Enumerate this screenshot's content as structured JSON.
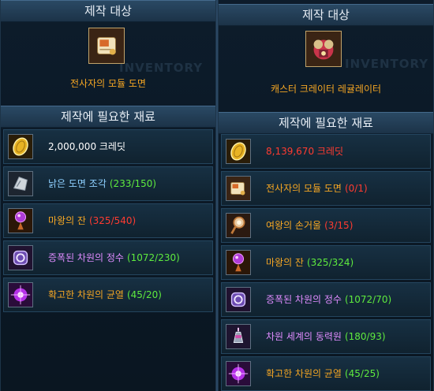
{
  "left": {
    "target_header": "제작 대상",
    "target_name": "전사자의 모듈 도면",
    "target_icon": "blueprint-scroll-icon",
    "materials_header": "제작에 필요한 재료",
    "watermark": "INVENTORY",
    "materials": [
      {
        "icon": "credit-coin-icon",
        "name": "2,000,000 크레딧",
        "count": "",
        "name_color": "#ffffff",
        "count_color": "#ffffff"
      },
      {
        "icon": "old-blueprint-piece-icon",
        "name": "낡은 도면 조각",
        "count": "(233/150)",
        "name_color": "#8ed0ff",
        "count_color": "#5eea3e"
      },
      {
        "icon": "demon-cup-icon",
        "name": "마왕의 잔",
        "count": "(325/540)",
        "name_color": "#f5a623",
        "count_color": "#ff3b30"
      },
      {
        "icon": "amplified-dimension-essence-icon",
        "name": "증폭된 차원의 정수",
        "count": "(1072/230)",
        "name_color": "#e08cff",
        "count_color": "#5eea3e"
      },
      {
        "icon": "dimension-rift-icon",
        "name": "확고한 차원의 균열",
        "count": "(45/20)",
        "name_color": "#f5a623",
        "count_color": "#5eea3e"
      }
    ]
  },
  "right": {
    "target_header": "제작 대상",
    "target_name": "캐스터 크레이터 레귤레이터",
    "target_icon": "caster-crater-regulator-icon",
    "materials_header": "제작에 필요한 재료",
    "watermark": "INVENTORY",
    "materials": [
      {
        "icon": "credit-coin-icon",
        "name": "8,139,670 크레딧",
        "count": "",
        "name_color": "#ff3b30",
        "count_color": "#ff3b30"
      },
      {
        "icon": "blueprint-scroll-icon",
        "name": "전사자의 모듈 도면",
        "count": "(0/1)",
        "name_color": "#f5a623",
        "count_color": "#ff3b30"
      },
      {
        "icon": "queen-mirror-icon",
        "name": "여왕의 손거울",
        "count": "(3/15)",
        "name_color": "#f5a623",
        "count_color": "#ff3b30"
      },
      {
        "icon": "demon-cup-icon",
        "name": "마왕의 잔",
        "count": "(325/324)",
        "name_color": "#f5a623",
        "count_color": "#5eea3e"
      },
      {
        "icon": "amplified-dimension-essence-icon",
        "name": "증폭된 차원의 정수",
        "count": "(1072/70)",
        "name_color": "#e08cff",
        "count_color": "#5eea3e"
      },
      {
        "icon": "dimension-world-power-icon",
        "name": "차원 세계의 동력원",
        "count": "(180/93)",
        "name_color": "#e08cff",
        "count_color": "#5eea3e"
      },
      {
        "icon": "dimension-rift-icon",
        "name": "확고한 차원의 균열",
        "count": "(45/25)",
        "name_color": "#f5a623",
        "count_color": "#5eea3e"
      }
    ]
  }
}
